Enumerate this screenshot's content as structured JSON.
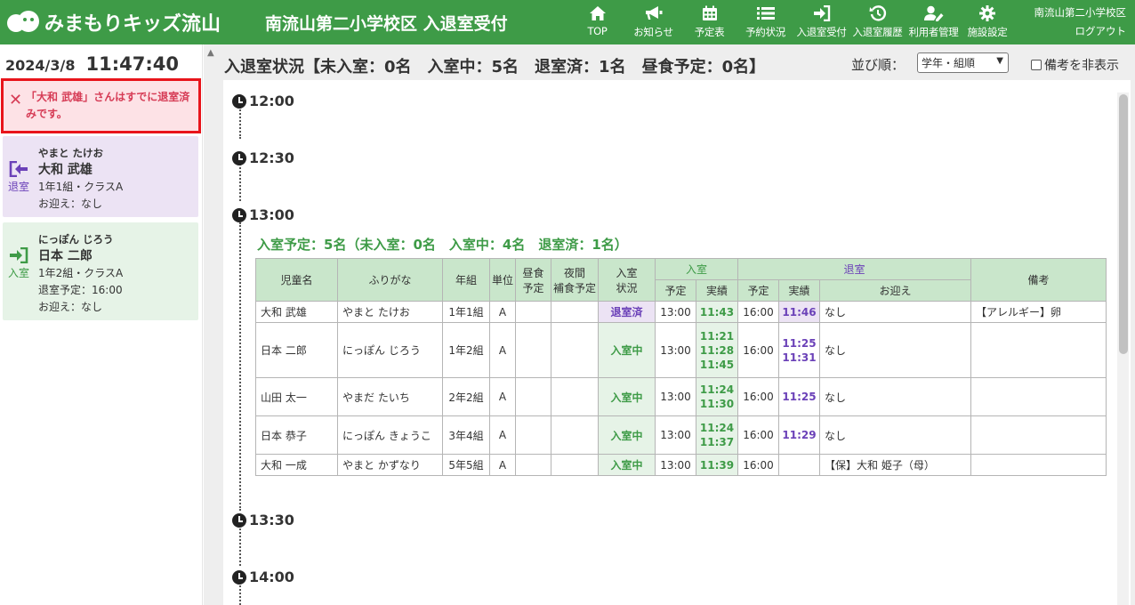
{
  "header": {
    "logo_text": "みまもりキッズ流山",
    "title": "南流山第二小学校区 入退室受付",
    "nav": [
      {
        "label": "TOP",
        "icon": "home-icon"
      },
      {
        "label": "お知らせ",
        "icon": "megaphone-icon"
      },
      {
        "label": "予定表",
        "icon": "calendar-icon"
      },
      {
        "label": "予約状況",
        "icon": "list-icon"
      },
      {
        "label": "入退室受付",
        "icon": "sign-in-icon"
      },
      {
        "label": "入退室履歴",
        "icon": "history-icon"
      },
      {
        "label": "利用者管理",
        "icon": "user-edit-icon"
      },
      {
        "label": "施設設定",
        "icon": "gear-icon"
      }
    ],
    "school": "南流山第二小学校区",
    "logout": "ログアウト"
  },
  "sidebar": {
    "date": "2024/3/8",
    "time": "11:47:40",
    "alert": "「大和 武雄」さんはすでに退室済みです。",
    "cards": [
      {
        "action": "退室",
        "kana": "やまと たけお",
        "name": "大和 武雄",
        "class": "1年1組・クラスA",
        "line3": "お迎え：なし",
        "line4": ""
      },
      {
        "action": "入室",
        "kana": "にっぽん じろう",
        "name": "日本 二郎",
        "class": "1年2組・クラスA",
        "line3": "退室予定：16:00",
        "line4": "お迎え：なし"
      }
    ]
  },
  "main": {
    "status_title": "入退室状況【未入室：0名　入室中：5名　退室済：1名　昼食予定：0名】",
    "sort_label": "並び順：",
    "sort_value": "学年・組順",
    "hide_remarks": "備考を非表示",
    "times": [
      "12:00",
      "12:30",
      "13:00",
      "13:30",
      "14:00"
    ],
    "group_summary": "入室予定：5名（未入室：0名　入室中：4名　退室済：1名）",
    "table": {
      "headers": {
        "name": "児童名",
        "kana": "ふりがな",
        "grade": "年組",
        "unit": "単位",
        "lunch1": "昼食",
        "lunch2": "予定",
        "night1": "夜間",
        "night2": "補食予定",
        "status1": "入室",
        "status2": "状況",
        "in": "入室",
        "out": "退室",
        "in_plan": "予定",
        "in_actual": "実績",
        "out_plan": "予定",
        "out_actual": "実績",
        "pickup": "お迎え",
        "remarks": "備考"
      },
      "rows": [
        {
          "name": "大和 武雄",
          "kana": "やまと たけお",
          "grade": "1年1組",
          "unit": "A",
          "lunch": "",
          "night": "",
          "status": "退室済",
          "in_plan": "13:00",
          "in_actual": "11:43",
          "out_plan": "16:00",
          "out_actual": "11:46",
          "pickup": "なし",
          "remarks": "【アレルギー】卵"
        },
        {
          "name": "日本 二郎",
          "kana": "にっぽん じろう",
          "grade": "1年2組",
          "unit": "A",
          "lunch": "",
          "night": "",
          "status": "入室中",
          "in_plan": "13:00",
          "in_actual": "11:21\n11:28\n11:45",
          "out_plan": "16:00",
          "out_actual": "11:25\n11:31",
          "pickup": "なし",
          "remarks": ""
        },
        {
          "name": "山田 太一",
          "kana": "やまだ たいち",
          "grade": "2年2組",
          "unit": "A",
          "lunch": "",
          "night": "",
          "status": "入室中",
          "in_plan": "13:00",
          "in_actual": "11:24\n11:30",
          "out_plan": "16:00",
          "out_actual": "11:25",
          "pickup": "なし",
          "remarks": ""
        },
        {
          "name": "日本 恭子",
          "kana": "にっぽん きょうこ",
          "grade": "3年4組",
          "unit": "A",
          "lunch": "",
          "night": "",
          "status": "入室中",
          "in_plan": "13:00",
          "in_actual": "11:24\n11:37",
          "out_plan": "16:00",
          "out_actual": "11:29",
          "pickup": "なし",
          "remarks": ""
        },
        {
          "name": "大和 一成",
          "kana": "やまと かずなり",
          "grade": "5年5組",
          "unit": "A",
          "lunch": "",
          "night": "",
          "status": "入室中",
          "in_plan": "13:00",
          "in_actual": "11:39",
          "out_plan": "16:00",
          "out_actual": "",
          "pickup": "【保】大和 姫子（母）",
          "remarks": ""
        }
      ]
    }
  },
  "colors": {
    "brand_green": "#3e9b47",
    "purple": "#6b41b8",
    "alert_red": "#e8141b"
  }
}
